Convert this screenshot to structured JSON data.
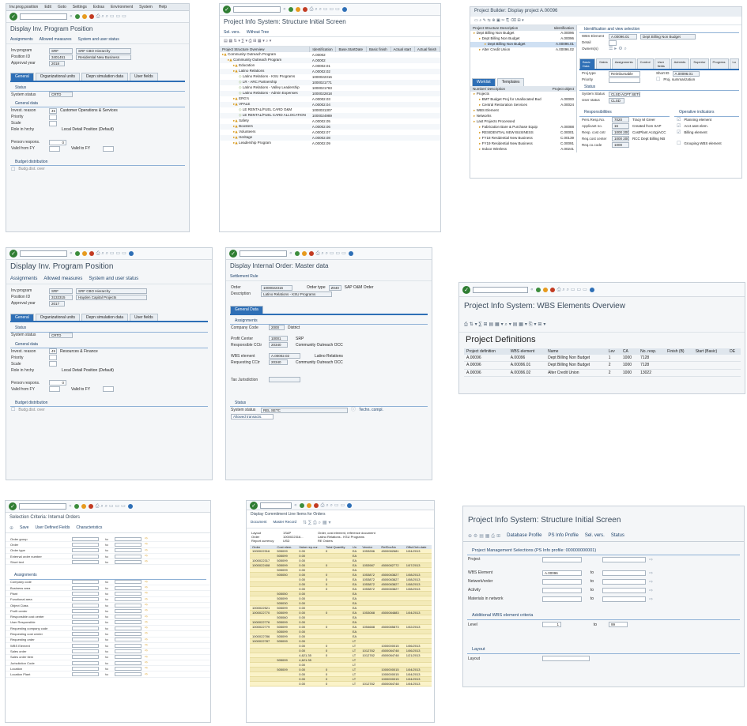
{
  "s1": {
    "menu": [
      "Inv.prog.position",
      "Edit",
      "Goto",
      "Settings",
      "Extras",
      "Environment",
      "System",
      "Help"
    ],
    "title": "Display Inv. Program Position",
    "app": [
      "Assignments",
      "Allowed measures",
      "System and user status"
    ],
    "header": [
      {
        "label": "Inv.program",
        "value": "SRF",
        "desc": "SRF CBO Hierarchy"
      },
      {
        "label": "Position ID",
        "value": "3401451",
        "desc": "Residential New Business"
      },
      {
        "label": "Approval year",
        "value": "2018",
        "desc": ""
      }
    ],
    "tabs": [
      "General",
      "Organizational units",
      "Depn simulation data",
      "User fields"
    ],
    "status_head": "Status",
    "sys_status_label": "System status",
    "sys_status": "CRTD",
    "general_head": "General data",
    "invest_label": "Invest. reason",
    "invest_code": "45",
    "invest_text": "Customer Operations & Services",
    "priority": "Priority",
    "scale": "Scale",
    "role_label": "Role in hrchy",
    "role_value": "Local Detail Position (Default)",
    "person_label": "Person respons.",
    "person_value": "0",
    "valid_from": "Valid from FY",
    "valid_to": "Valid to FY",
    "budget_head": "Budget distribution",
    "budget_text": "Budg.dist. over"
  },
  "s2": {
    "title": "Project Info System: Structure Initial Screen",
    "app": [
      "Sel. vers.",
      "Without Tree"
    ],
    "cols": [
      "Project Structure Overview",
      "Identification",
      "Base.StartDate",
      "Basic finish",
      "Actual start",
      "Actual finish"
    ],
    "rows": [
      {
        "t": "Community Outreach Program",
        "id": "A.00002",
        "d": 0
      },
      {
        "t": "Community Outreach Program",
        "id": "A.00002",
        "d": 1
      },
      {
        "t": "Education",
        "id": "A.00002.01",
        "d": 2
      },
      {
        "t": "Latino Relations",
        "id": "A.00002.02",
        "d": 2
      },
      {
        "t": "Latino Relations - KSU Programs",
        "id": "1000022316",
        "d": 3
      },
      {
        "t": "LR - ARC Partnership",
        "id": "1000021771",
        "d": 3
      },
      {
        "t": "Latino Relations - Valley Leadership",
        "id": "1000021783",
        "d": 3
      },
      {
        "t": "Latino Relations - Admin Expenses",
        "id": "1000022818",
        "d": 3
      },
      {
        "t": "ERG's",
        "id": "A.00002.03",
        "d": 2
      },
      {
        "t": "VPALE",
        "id": "A.00002.04",
        "d": 2
      },
      {
        "t": "LE RENTAL/FUEL CARD O&M",
        "id": "1000031307",
        "d": 3
      },
      {
        "t": "LE RENTAL/FUEL CARD ALLOCATION",
        "id": "1000024989",
        "d": 3
      },
      {
        "t": "Safety",
        "id": "A.00002.05",
        "d": 2
      },
      {
        "t": "Boosters",
        "id": "A.00002.06",
        "d": 2
      },
      {
        "t": "Volunteers",
        "id": "A.00002.07",
        "d": 2
      },
      {
        "t": "Heritage",
        "id": "A.00002.08",
        "d": 2
      },
      {
        "t": "Leadership Program",
        "id": "A.00002.09",
        "d": 2
      }
    ]
  },
  "s3": {
    "title": "Project Builder: Display project A.00096",
    "tree_head": [
      "Project Structure Description",
      "Identification"
    ],
    "tree": [
      {
        "t": "Dept Billing Non Budget",
        "id": "A.00096",
        "d": 0
      },
      {
        "t": "Dept Billing Non Budget",
        "id": "A.00096",
        "d": 1
      },
      {
        "t": "Dept Billing Non Budget",
        "id": "A.00096.01",
        "d": 2
      },
      {
        "t": "Alter Credit Union",
        "id": "A.00096.02",
        "d": 1
      }
    ],
    "id_head": "Identification and view selection",
    "wbs_label": "WBS Element",
    "wbs_value": "A.00096.01",
    "wbs_desc": "Dept Billing Non Budget",
    "detail": "Detail",
    "owner": "Owners(s)",
    "tabs": [
      "Basic Data",
      "Dates",
      "Assignments",
      "Control",
      "User fields",
      "Admintn.",
      "Superior",
      "Progress",
      "Lo"
    ],
    "pt_label": "Proj.type",
    "pt_value": "Reimbursable",
    "short_label": "Short ID",
    "short_value": "A.00096.01",
    "prio": "Priority",
    "prj_summ": "Proj. summarization",
    "stat_head": "Status",
    "sys_label": "System Status",
    "sys_value": "CLSD ACPT SETC",
    "user_label": "User status",
    "user_value": "CLSD",
    "resp_head": "Responsibilities",
    "op_head": "Operative indicators",
    "resp": [
      {
        "l": "Pers.Resp.No.",
        "v": "7020",
        "d": "Tracy M Greer"
      },
      {
        "l": "Applicant no.",
        "v": "16",
        "d": "Created from SAP"
      },
      {
        "l": "Resp. cost cntr",
        "v": "1000 20065",
        "d": "CostPlant Acctg/ACC"
      },
      {
        "l": "Req.cost center",
        "v": "1000 20065",
        "d": "RCC Dept Billing NB"
      },
      {
        "l": "Req.co.code",
        "v": "1000",
        "d": ""
      }
    ],
    "ops": [
      "Planning element",
      "Acct asst elem.",
      "Billing element",
      "Grouping WBS element"
    ],
    "lower_tabs": [
      "Worklist",
      "Templates"
    ],
    "lower_head": [
      "Number/ Description",
      "Project object"
    ],
    "lower": [
      {
        "t": "Projects",
        "id": "",
        "d": 0
      },
      {
        "t": "BMT Budget Proj for Unallocated Bud",
        "id": "A.00000",
        "d": 1
      },
      {
        "t": "Central Restoration Services",
        "id": "A.00024",
        "d": 1
      },
      {
        "t": "WBS Element",
        "id": "",
        "d": 0
      },
      {
        "t": "Networks",
        "id": "",
        "d": 0
      },
      {
        "t": "Last Projects Processed",
        "id": "",
        "d": 0
      },
      {
        "t": "Fabrication Bare & Purchase Equip",
        "id": "A.00088",
        "d": 1
      },
      {
        "t": "RESIDENTIAL NEW BUSINESS",
        "id": "C.00001",
        "d": 1
      },
      {
        "t": "FY18 Residential New Business",
        "id": "C.00139",
        "d": 1
      },
      {
        "t": "FY19 Residential New Business",
        "id": "C.00091",
        "d": 1
      },
      {
        "t": "Indoor Wireless",
        "id": "A.00241",
        "d": 1
      }
    ]
  },
  "s4": {
    "title": "Display Inv. Program Position",
    "app": [
      "Assignments",
      "Allowed measures",
      "System and user status"
    ],
    "header": [
      {
        "label": "Inv.program",
        "value": "SRF",
        "desc": "SRF CBO Hierarchy"
      },
      {
        "label": "Position ID",
        "value": "3132315",
        "desc": "Hayden Capital Projects"
      },
      {
        "label": "Approval year",
        "value": "2017",
        "desc": ""
      }
    ],
    "tabs": [
      "General",
      "Organizational units",
      "Depn simulation data",
      "User fields"
    ],
    "status_head": "Status",
    "sys_status_label": "System status",
    "sys_status": "CRTD",
    "general_head": "General data",
    "invest_label": "Invest. reason",
    "invest_code": "49",
    "invest_text": "Resources & Finance",
    "priority": "Priority",
    "scale": "Scale",
    "role_label": "Role in hrchy",
    "role_value": "Local Detail Position (Default)",
    "person_label": "Person respons.",
    "person_value": "0",
    "valid_from": "Valid from FY",
    "valid_to": "Valid to FY",
    "budget_head": "Budget distribution",
    "budget_text": "Budg.dist. over"
  },
  "s5": {
    "title": "Display Internal Order: Master data",
    "settlement": "Settlement Rule",
    "order_label": "Order",
    "order_value": "1000022316",
    "otype_label": "Order type",
    "otype_value": "Z040",
    "otype_desc": "SAP O&M Order",
    "desc_label": "Description",
    "desc_value": "Latino Relations - KSU Programs",
    "tab": "General Data",
    "assign_head": "Assignments",
    "company_label": "Company Code",
    "company_value": "2000",
    "company_desc": "District",
    "pc_label": "Profit Center",
    "pc_value": "10001",
    "pc_desc": "SRP",
    "rcc_label": "Responsible CCtr",
    "rcc_value": "20340",
    "rcc_desc": "Community Outreach OCC",
    "wbs_label": "WBS element",
    "wbs_value": "A.00002.02",
    "wbs_desc": "Latino Relations",
    "reqcc_label": "Requesting CCtr",
    "reqcc_value": "20340",
    "reqcc_desc": "Community Outreach OCC",
    "tax_label": "Tax Jurisdiction",
    "status_head": "Status",
    "sys_label": "System status",
    "sys_value": "REL  SETC",
    "allowed": "Allowed transacts.",
    "techn": "Techn. compl."
  },
  "s6": {
    "title": "Project Info System: WBS Elements Overview",
    "heading": "Project Definitions",
    "cols": [
      "Project definition",
      "WBS element",
      "Name",
      "Lev",
      "CA",
      "No. resp.",
      "Finish (B)",
      "Start (Basic)",
      "DE"
    ],
    "rows": [
      [
        "A.00096",
        "A.00096",
        "Dept Billing Non Budget",
        "1",
        "1000",
        "7128",
        "",
        "",
        ""
      ],
      [
        "A.00096",
        "A.00096.01",
        "Dept Billing Non Budget",
        "2",
        "1000",
        "7128",
        "",
        "",
        ""
      ],
      [
        "A.00096",
        "A.00096.02",
        "Alter Credit Union",
        "2",
        "1000",
        "13022",
        "",
        "",
        ""
      ]
    ]
  },
  "s7": {
    "title": "Selection Criteria: Internal Orders",
    "app": [
      "Save",
      "User Defined Fields",
      "Characteristics"
    ],
    "top": [
      "Order group",
      "Order",
      "Order type",
      "External order number",
      "Short text"
    ],
    "assign_head": "Assignments",
    "fields": [
      "Company code",
      "Business area",
      "Plant",
      "Functional area",
      "Object Class",
      "Profit center",
      "Responsible cost center",
      "User Responsible",
      "Requesting company code",
      "Requesting cost center",
      "Requesting order",
      "WBS Element",
      "Sales order",
      "Sales order item",
      "Jurisdiction Code",
      "Location",
      "Location Plant"
    ],
    "to": "to"
  },
  "s8": {
    "title": "Display Commitment Line Items for Orders",
    "app": [
      "Document",
      "Master Record"
    ],
    "meta": [
      "Layout",
      "Order",
      "Report currency"
    ],
    "meta_v": [
      "1SAP",
      "1000022316...",
      "USD"
    ],
    "meta_d": [
      "Order, cost element, reference document",
      "Latino Relations - KSU Programs",
      "RE Orders"
    ],
    "cols": [
      "Order",
      "Cost elem.",
      "Value rep.cur.",
      "Total Quantity",
      "Un",
      "Vendor",
      "RefDocNo",
      "Offst.Deb.date"
    ],
    "rows": [
      [
        "1000022316",
        "505099",
        "0.00",
        "0",
        "EA",
        "1053286",
        "4500082681",
        "1/04/2013"
      ],
      [
        "",
        "505099",
        "0.00",
        "",
        "EA",
        "",
        "",
        ""
      ],
      [
        "1000022317",
        "505099",
        "0.00",
        "",
        "EA",
        "",
        "",
        ""
      ],
      [
        "1000022408",
        "505099",
        "0.00",
        "0",
        "EA",
        "1053987",
        "4500082772",
        "1/07/2013"
      ],
      [
        "",
        "505099",
        "0.00",
        "",
        "EA",
        "",
        "",
        ""
      ],
      [
        "",
        "505050",
        "0.00",
        "0",
        "EA",
        "1053872",
        "4500083827",
        "1/08/2013"
      ],
      [
        "",
        "",
        "0.00",
        "0",
        "EA",
        "1053872",
        "4500083827",
        "1/08/2013"
      ],
      [
        "",
        "",
        "0.00",
        "0",
        "EA",
        "1053872",
        "4500083827",
        "1/08/2013"
      ],
      [
        "",
        "",
        "0.00",
        "0",
        "EA",
        "1053872",
        "4500083827",
        "1/08/2013"
      ],
      [
        "",
        "505050",
        "0.00",
        "",
        "EA",
        "",
        "",
        ""
      ],
      [
        "",
        "505099",
        "0.00",
        "",
        "EA",
        "",
        "",
        ""
      ],
      [
        "",
        "505030",
        "0.00",
        "",
        "EA",
        "",
        "",
        ""
      ],
      [
        "1000022521",
        "505099",
        "0.00",
        "",
        "EA",
        "",
        "",
        ""
      ],
      [
        "1000022770",
        "505099",
        "0.00",
        "0",
        "EA",
        "1053088",
        "4500084883",
        "1/04/2013"
      ],
      [
        "",
        "505060",
        "0.00",
        "",
        "EA",
        "",
        "",
        ""
      ],
      [
        "1000022776",
        "505099",
        "0.00",
        "",
        "EA",
        "",
        "",
        ""
      ],
      [
        "1000022779",
        "505099",
        "0.00",
        "0",
        "EA",
        "1054688",
        "4500085873",
        "1/02/2013"
      ],
      [
        "",
        "505099",
        "0.00",
        "",
        "EA",
        "",
        "",
        ""
      ],
      [
        "1000022786",
        "505099",
        "0.00",
        "",
        "EA",
        "",
        "",
        ""
      ],
      [
        "1000022787",
        "505099",
        "0.00",
        "",
        "LT",
        "",
        "",
        ""
      ],
      [
        "",
        "",
        "0.00",
        "0",
        "LT",
        "",
        "1000000015",
        "1/06/2013"
      ],
      [
        "",
        "",
        "0.00",
        "0",
        "LT",
        "1012782",
        "4500084748",
        "1/06/2013"
      ],
      [
        "",
        "",
        "4,621.35",
        "0",
        "LT",
        "1012782",
        "4500084748",
        "1/21/2013"
      ],
      [
        "",
        "505099",
        "4,621.35",
        "",
        "LT",
        "",
        "",
        ""
      ],
      [
        "",
        "",
        "0.00",
        "",
        "LT",
        "",
        "",
        ""
      ],
      [
        "",
        "505009",
        "0.00",
        "0",
        "LT",
        "",
        "1000000015",
        "1/04/2013"
      ],
      [
        "",
        "",
        "0.00",
        "0",
        "LT",
        "",
        "1000000015",
        "1/04/2013"
      ],
      [
        "",
        "",
        "0.00",
        "0",
        "LT",
        "",
        "1000000015",
        "1/04/2013"
      ],
      [
        "",
        "",
        "0.00",
        "0",
        "LT",
        "1012782",
        "4500084748",
        "1/04/2013"
      ]
    ]
  },
  "s9": {
    "title": "Project Info System: Structure Initial Screen",
    "app": [
      "Database Profile",
      "PS Info Profile",
      "Sel. vers.",
      "Status"
    ],
    "pm_head": "Project Management Selections (PS Info profile: 000000000001)",
    "project": "Project",
    "wbs": "WBS Element",
    "wbs_value": "A.00096",
    "network": "Network/order",
    "activity": "Activity",
    "material": "Materials in network",
    "add_head": "Additional WBS element criteria",
    "level": "Level",
    "level_from": "1",
    "level_to": "99",
    "to": "to",
    "layout_head": "Layout",
    "layout": "Layout"
  }
}
